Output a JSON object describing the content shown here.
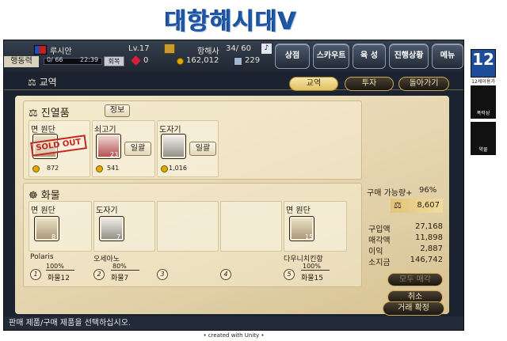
{
  "logo_text": "대항해시대V",
  "header": {
    "nation_name": "루시안",
    "level": "Lv.17",
    "captain_label": "항해사",
    "captain_count": "34/ 60",
    "action_label": "행동력",
    "action_value": "0/ 66",
    "time": "22:39",
    "recover_label": "회복",
    "gems": "0",
    "gold": "162,012",
    "ships": "229",
    "menu": [
      "상점",
      "스카우트",
      "육 성",
      "진행상황",
      "메뉴"
    ]
  },
  "trade": {
    "title": "교역",
    "tabs": [
      "교역",
      "투자",
      "돌아가기"
    ],
    "specialty_title": "진열품",
    "info_label": "정보",
    "specialty_items": [
      {
        "name": "면 원단",
        "badge": "SOLD OUT",
        "price": "872",
        "qty": ""
      },
      {
        "name": "쇠고기",
        "badge": "",
        "price": "541",
        "qty": "23",
        "bulk": "일괄"
      },
      {
        "name": "도자기",
        "badge": "",
        "price": "1,016",
        "qty": "",
        "bulk": "일괄"
      }
    ],
    "cargo_title": "화물",
    "cargo_slots": [
      {
        "item": "면 원단",
        "qty": "8",
        "ship_name": "Polaris",
        "percent": "100%",
        "load": "화물12",
        "num": "1"
      },
      {
        "item": "도자기",
        "qty": "7",
        "ship_name": "오세아노",
        "percent": "80%",
        "load": "화물7",
        "num": "2"
      },
      {
        "item": "",
        "qty": "",
        "ship_name": "",
        "percent": "",
        "load": "",
        "num": "3"
      },
      {
        "item": "",
        "qty": "",
        "ship_name": "",
        "percent": "",
        "load": "",
        "num": "4"
      },
      {
        "item": "면 원단",
        "qty": "15",
        "ship_name": "다우니치킨항",
        "percent": "100%",
        "load": "화물15",
        "num": "5"
      }
    ],
    "buy_label": "구매 가능량+",
    "buy_percent": "96%",
    "tax_value": "8,607",
    "summary": [
      {
        "label": "구입액",
        "value": "27,168"
      },
      {
        "label": "매각액",
        "value": "11,898"
      },
      {
        "label": "이익",
        "value": "2,887"
      },
      {
        "label": "소지금",
        "value": "146,742"
      }
    ],
    "sell_all": "모두 매각",
    "cancel": "취소",
    "confirm": "거래 확정"
  },
  "footer_text": "판매 제품/구매 제품을 선택하십시오.",
  "credit": "• created with Unity •",
  "side": {
    "rating_num": "12",
    "rating_label": "12세이용가",
    "violence_label": "폭력성",
    "drug_label": "약물"
  },
  "colors": {
    "frame": "#1b2230",
    "accent": "#e0c060",
    "logo": "#1e57a6"
  }
}
